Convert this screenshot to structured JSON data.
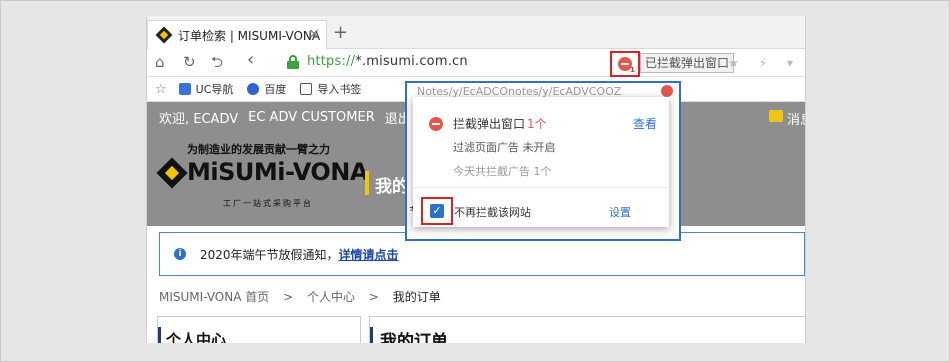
{
  "tab": {
    "title": "订单检索 | MISUMI-VONA",
    "close": "×",
    "new_tab": "+"
  },
  "nav": {
    "home": "⌂",
    "reload": "↻",
    "back_history": "⮌",
    "back": "‹",
    "url_scheme": "https://",
    "url_rest": "*.misumi.com.cn",
    "popup_count": "1",
    "blocked_label": "已拦截弹出窗口",
    "right_icons": "★ ⚡ ▾"
  },
  "bookmarks": {
    "star": "☆",
    "items": [
      {
        "label": "UC导航"
      },
      {
        "label": "百度"
      },
      {
        "label": "导入书签"
      }
    ]
  },
  "site": {
    "welcome": "欢迎, ECADV",
    "company": "EC ADV CUSTOMER",
    "logout": "退出",
    "messages": "消息",
    "slogan": "为制造业的发展贡献一臂之力",
    "logo": "MiSUMi-VONA",
    "logo_sub": "工厂一站式采购平台",
    "header_title": "我的"
  },
  "notice": {
    "text": "2020年端午节放假通知，",
    "link": "详情请点击"
  },
  "breadcrumb": {
    "home": "MISUMI-VONA 首页",
    "sep": ">",
    "personal": "个人中心",
    "current": "我的订单"
  },
  "left_card": {
    "title": "个人中心"
  },
  "right_card": {
    "title": "我的订单"
  },
  "panel": {
    "ghost_text": "Notes/y/EcADCOnotes/y/EcADVCOOZ",
    "blocked_text": "拦截弹出窗口",
    "blocked_count": "1个",
    "view": "查看",
    "filter": "过滤页面广告 未开启",
    "today": "今天共拦截广告 1个",
    "checkbox_label": "不再拦截该网站",
    "settings": "设置",
    "left_fragment": "节"
  }
}
